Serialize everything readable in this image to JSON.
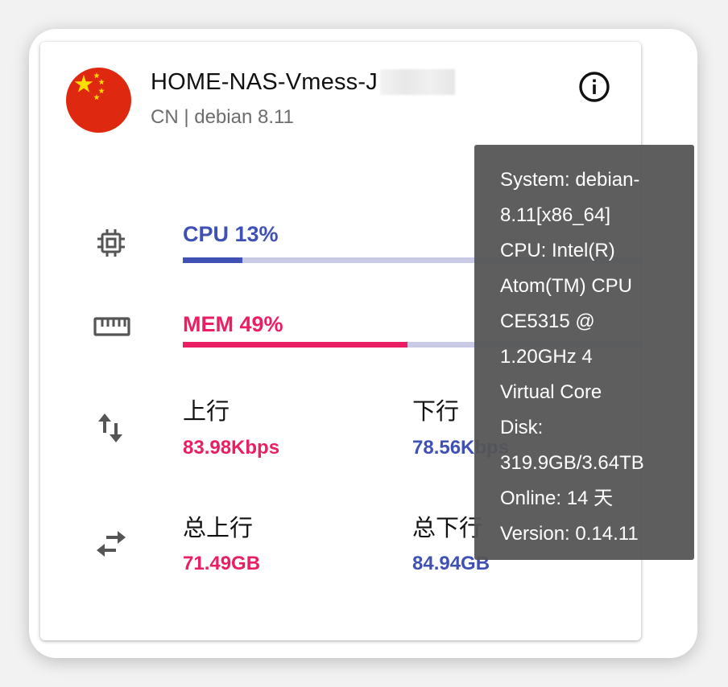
{
  "server": {
    "name": "HOME-NAS-Vmess-J",
    "country_code": "CN",
    "os": "debian 8.11",
    "subtitle": "CN | debian 8.11",
    "flag": "china-flag"
  },
  "cpu": {
    "label": "CPU 13%",
    "percent": 13
  },
  "mem": {
    "label": "MEM 49%",
    "percent": 49
  },
  "network": {
    "up_label": "上行",
    "up_value": "83.98Kbps",
    "down_label": "下行",
    "down_value": "78.56Kbps"
  },
  "traffic": {
    "total_up_label": "总上行",
    "total_up_value": "71.49GB",
    "total_down_label": "总下行",
    "total_down_value": "84.94GB"
  },
  "tooltip": {
    "lines": [
      "System: debian-",
      "8.11[x86_64]",
      "CPU: Intel(R)",
      "Atom(TM) CPU",
      "CE5315 @",
      "1.20GHz 4",
      "Virtual Core",
      "Disk:",
      "319.9GB/3.64TB",
      "Online: 14 天",
      "Version: 0.14.11"
    ]
  },
  "icons": {
    "info": "info-icon",
    "cpu": "cpu-chip-icon",
    "memory": "memory-icon",
    "network": "swap-vertical-icon",
    "traffic": "swap-horizontal-icon"
  },
  "colors": {
    "cpu_accent": "#3f51b5",
    "mem_accent": "#e91e63",
    "track": "#c9cbe6",
    "tooltip_bg": "#555555"
  }
}
